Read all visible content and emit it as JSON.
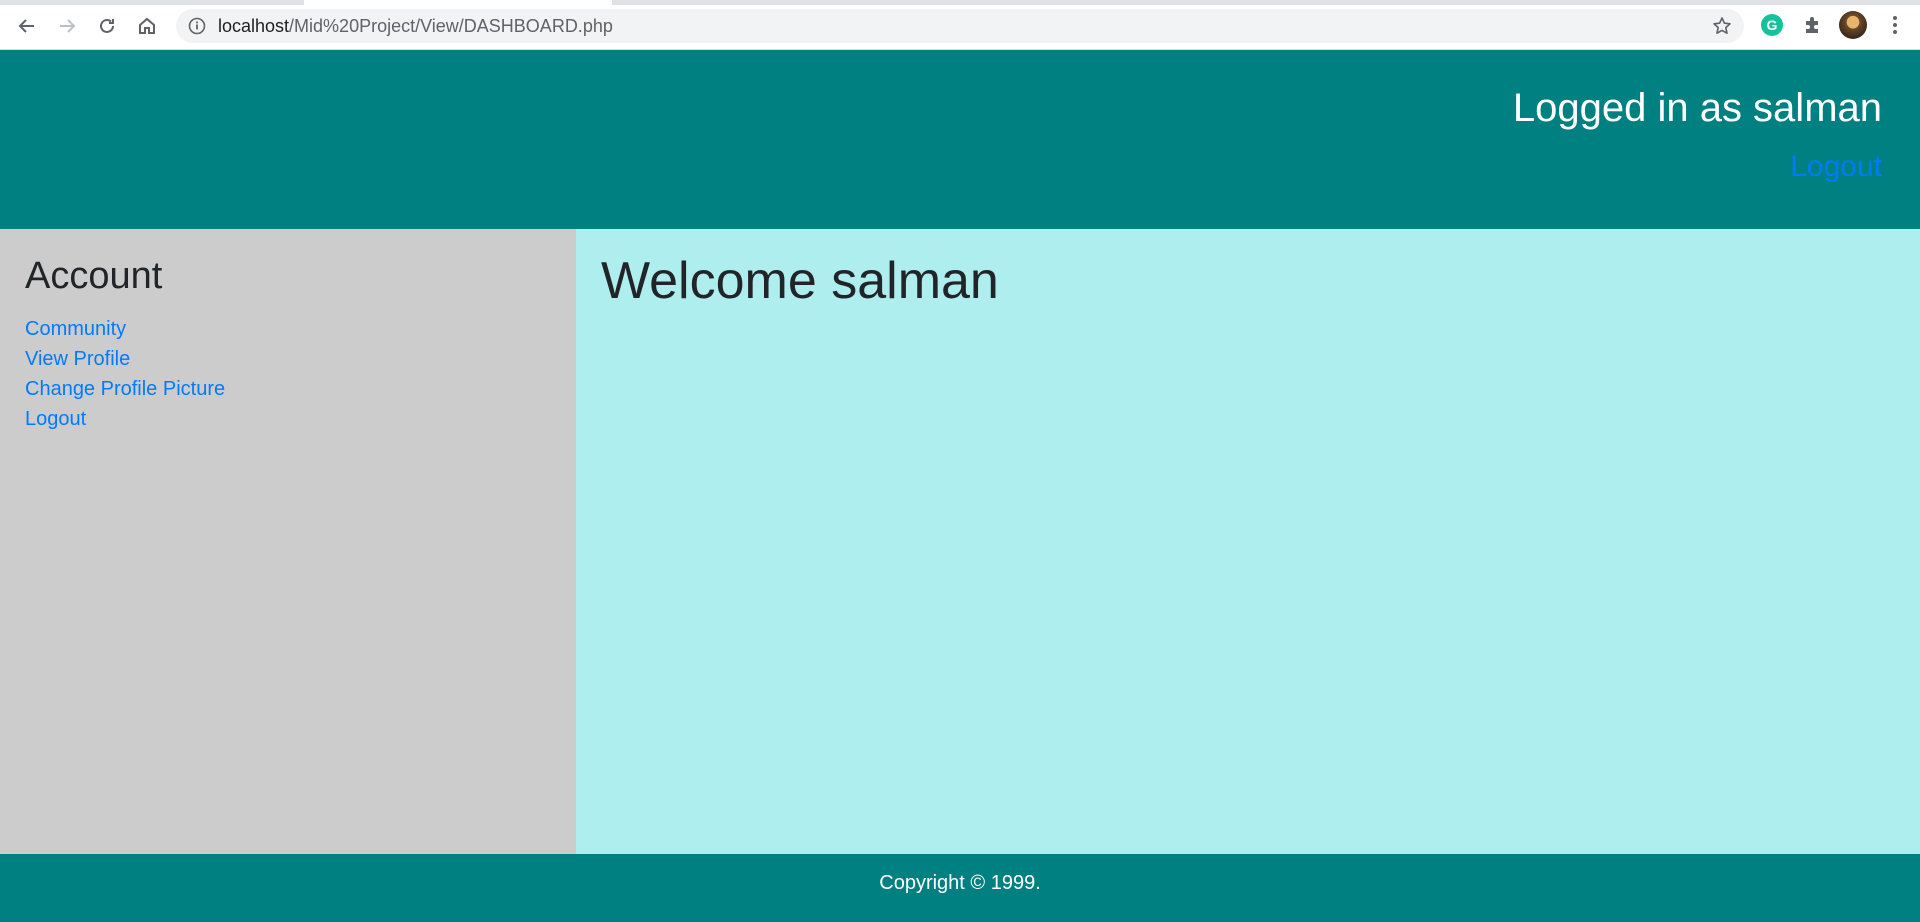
{
  "browser": {
    "url_host": "localhost",
    "url_path": "/Mid%20Project/View/DASHBOARD.php",
    "icons": [
      "back-icon",
      "forward-icon",
      "reload-icon",
      "home-icon",
      "info-icon",
      "bookmark-star-icon",
      "grammarly-extension-icon",
      "extensions-puzzle-icon",
      "profile-avatar",
      "kebab-menu-icon"
    ],
    "grammarly_letter": "G"
  },
  "header": {
    "logged_in_text": "Logged in as salman",
    "logout_label": "Logout"
  },
  "sidebar": {
    "title": "Account",
    "items": [
      {
        "label": "Community"
      },
      {
        "label": "View Profile"
      },
      {
        "label": "Change Profile Picture"
      },
      {
        "label": "Logout"
      }
    ]
  },
  "main": {
    "welcome": "Welcome salman"
  },
  "footer": {
    "copyright": "Copyright © 1999."
  },
  "colors": {
    "header_bg": "#008080",
    "sidebar_bg": "#cccccc",
    "content_bg": "#afeeee",
    "link": "#007bff"
  }
}
